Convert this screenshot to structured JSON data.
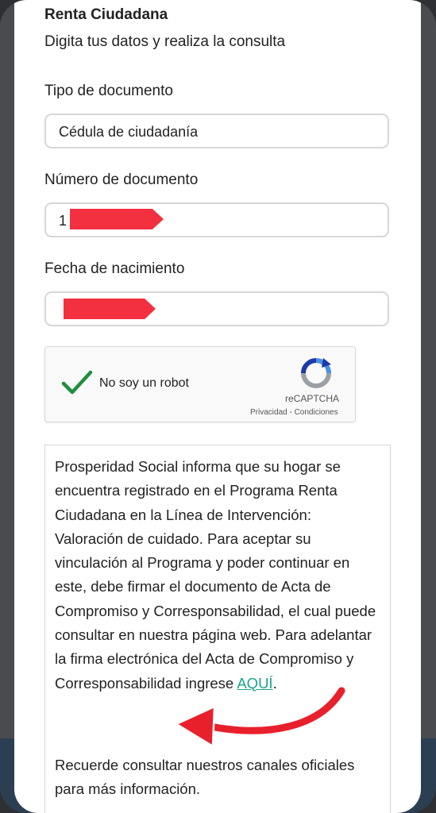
{
  "header": {
    "title": "Renta Ciudadana",
    "subtitle": "Digita tus datos y realiza la consulta"
  },
  "form": {
    "document_type": {
      "label": "Tipo de documento",
      "value": "Cédula de ciudadanía"
    },
    "document_number": {
      "label": "Número de documento",
      "value_visible": "1"
    },
    "birth_date": {
      "label": "Fecha de nacimiento"
    }
  },
  "recaptcha": {
    "label": "No soy un robot",
    "brand": "reCAPTCHA",
    "links": "Privacidad - Condiciones",
    "checked": true,
    "check_color": "#1e8e3e"
  },
  "notice": {
    "text_before_link": "Prosperidad Social informa que su hogar se encuentra registrado en el Programa Renta Ciudadana en la Línea de Intervención: Valoración de cuidado. Para aceptar su vinculación al Programa y poder continuar en este, debe firmar el documento de Acta de Compromiso y Corresponsabilidad, el cual puede consultar en nuestra página web. Para adelantar la firma electrónica del Acta de Compromiso y Corresponsabilidad ingrese ",
    "link_text": "AQUÍ",
    "text_after_link": ".",
    "second_paragraph": "Recuerde consultar nuestros canales oficiales para más información."
  },
  "colors": {
    "link": "#1aa58a",
    "redaction": "#f2303f",
    "arrow": "#e8202c"
  }
}
